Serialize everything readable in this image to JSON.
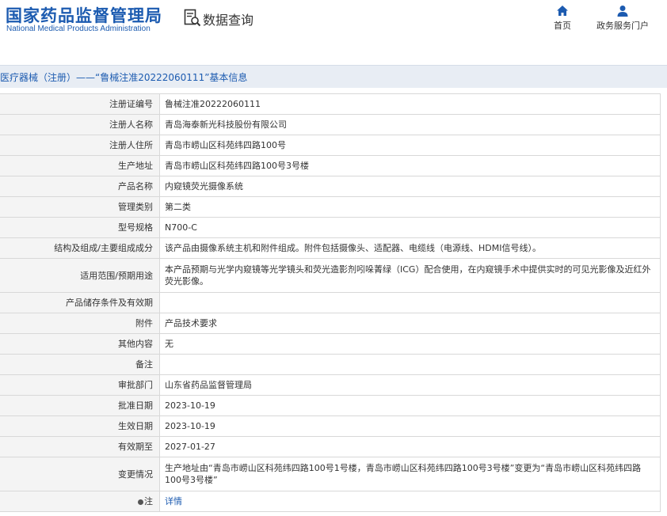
{
  "header": {
    "logo_cn": "国家药品监督管理局",
    "logo_en": "National Medical Products Administration",
    "search_title": "数据查询",
    "nav": [
      {
        "label": "首页",
        "icon": "home-icon"
      },
      {
        "label": "政务服务门户",
        "icon": "user-icon"
      }
    ]
  },
  "title_bar": {
    "text": "医疗器械（注册）——“鲁械注准20222060111”基本信息"
  },
  "rows": [
    {
      "label": "注册证编号",
      "value": "鲁械注准20222060111"
    },
    {
      "label": "注册人名称",
      "value": "青岛海泰新光科技股份有限公司"
    },
    {
      "label": "注册人住所",
      "value": "青岛市崂山区科苑纬四路100号"
    },
    {
      "label": "生产地址",
      "value": "青岛市崂山区科苑纬四路100号3号楼"
    },
    {
      "label": "产品名称",
      "value": "内窥镜荧光摄像系统"
    },
    {
      "label": "管理类别",
      "value": "第二类"
    },
    {
      "label": "型号规格",
      "value": "N700-C"
    },
    {
      "label": "结构及组成/主要组成成分",
      "value": "该产品由摄像系统主机和附件组成。附件包括摄像头、适配器、电缆线（电源线、HDMI信号线）。"
    },
    {
      "label": "适用范围/预期用途",
      "value": "本产品预期与光学内窥镜等光学镜头和荧光造影剂吲哚菁绿（ICG）配合使用，在内窥镜手术中提供实时的可见光影像及近红外荧光影像。"
    },
    {
      "label": "产品储存条件及有效期",
      "value": ""
    },
    {
      "label": "附件",
      "value": "产品技术要求"
    },
    {
      "label": "其他内容",
      "value": "无"
    },
    {
      "label": "备注",
      "value": ""
    },
    {
      "label": "审批部门",
      "value": "山东省药品监督管理局"
    },
    {
      "label": "批准日期",
      "value": "2023-10-19"
    },
    {
      "label": "生效日期",
      "value": "2023-10-19"
    },
    {
      "label": "有效期至",
      "value": "2027-01-27"
    },
    {
      "label": "变更情况",
      "value": "生产地址由“青岛市崂山区科苑纬四路100号1号楼，青岛市崂山区科苑纬四路100号3号楼”变更为“青岛市崂山区科苑纬四路100号3号楼”"
    },
    {
      "label": "注",
      "value": "详情"
    }
  ],
  "colors": {
    "brand_blue": "#1c5bb0",
    "title_bar_bg": "#e8edf4",
    "label_bg": "#f4f4f4"
  }
}
